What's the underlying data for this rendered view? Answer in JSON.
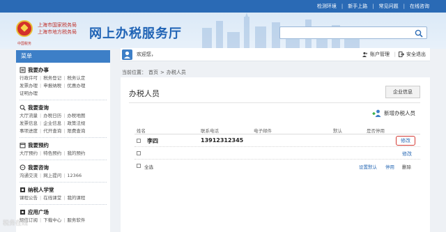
{
  "topbar": {
    "links": [
      "检测环境",
      "新手上路",
      "常见问题",
      "在线咨询"
    ]
  },
  "header": {
    "bureau_line1": "上海市国家税务局",
    "bureau_line2": "上海市地方税务局",
    "brand": "网上办税服务厅",
    "sub_brand": "中国税务",
    "search_placeholder": ""
  },
  "sidebar": {
    "title": "菜单",
    "sections": [
      {
        "icon": "document-icon",
        "title": "我要办事",
        "rows": [
          [
            "行政许可",
            "税务登记",
            "税务认定"
          ],
          [
            "发票办理",
            "申报纳税",
            "优惠办理"
          ],
          [
            "证明办理"
          ]
        ]
      },
      {
        "icon": "search-icon",
        "title": "我要查询",
        "rows": [
          [
            "大厅流量",
            "办税日历",
            "办税地图"
          ],
          [
            "发票信息",
            "企业信息",
            "政策法规"
          ],
          [
            "事项进度",
            "代开查询",
            "限费查询"
          ]
        ]
      },
      {
        "icon": "calendar-icon",
        "title": "我要预约",
        "rows": [
          [
            "大厅预约",
            "特色预约",
            "我的预约"
          ]
        ]
      },
      {
        "icon": "chat-icon",
        "title": "我要咨询",
        "rows": [
          [
            "沟通交流",
            "网上提问",
            "12366"
          ]
        ]
      },
      {
        "icon": "school-icon",
        "title": "纳税人学堂",
        "rows": [
          [
            "课程公告",
            "在线课堂",
            "我的课程"
          ]
        ]
      },
      {
        "icon": "broadcast-icon",
        "title": "应用广场",
        "rows": [
          [
            "短信订阅",
            "下载中心",
            "服务软件"
          ]
        ]
      }
    ]
  },
  "userbar": {
    "welcome": "欢迎您，",
    "account": "账户管理",
    "logout": "安全退出"
  },
  "breadcrumb": {
    "prefix": "当前位置：",
    "home": "首页",
    "arrow": ">",
    "current": "办税人员"
  },
  "main": {
    "title": "办税人员",
    "enterprise_button": "企业信息",
    "add_button": "新增办税人员",
    "columns": [
      "姓名",
      "联系电话",
      "电子邮件",
      "默认",
      "是否停用"
    ],
    "rows": [
      {
        "name": "李四",
        "phone": "13912312345",
        "email": "",
        "action": "修改"
      },
      {
        "name": "",
        "phone": "",
        "email": "",
        "action": "修改"
      }
    ],
    "footer": {
      "select_all": "全选",
      "set_default": "设置默认",
      "disable": "停用",
      "delete": "删除"
    }
  },
  "watermark": "税务在线",
  "colors": {
    "topbar": "#2a6ab5",
    "sidebar_header": "#3d7fc7",
    "brand": "#1f63b5",
    "highlight_border": "#d43a34"
  }
}
